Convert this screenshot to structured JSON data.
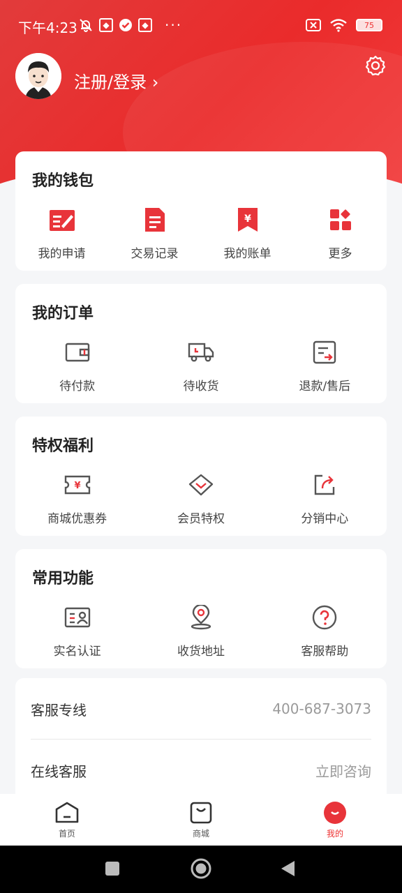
{
  "status": {
    "time": "下午4:23",
    "battery": "75"
  },
  "profile": {
    "login_label": "注册/登录",
    "chevron": "›"
  },
  "wallet": {
    "title": "我的钱包",
    "items": [
      {
        "label": "我的申请",
        "icon": "application-icon"
      },
      {
        "label": "交易记录",
        "icon": "document-icon"
      },
      {
        "label": "我的账单",
        "icon": "bill-icon"
      },
      {
        "label": "更多",
        "icon": "more-grid-icon"
      }
    ]
  },
  "orders": {
    "title": "我的订单",
    "items": [
      {
        "label": "待付款",
        "icon": "wallet-icon"
      },
      {
        "label": "待收货",
        "icon": "truck-icon"
      },
      {
        "label": "退款/售后",
        "icon": "refund-icon"
      }
    ]
  },
  "benefits": {
    "title": "特权福利",
    "items": [
      {
        "label": "商城优惠券",
        "icon": "coupon-icon"
      },
      {
        "label": "会员特权",
        "icon": "diamond-icon"
      },
      {
        "label": "分销中心",
        "icon": "share-icon"
      }
    ]
  },
  "functions": {
    "title": "常用功能",
    "items": [
      {
        "label": "实名认证",
        "icon": "id-card-icon"
      },
      {
        "label": "收货地址",
        "icon": "location-icon"
      },
      {
        "label": "客服帮助",
        "icon": "help-icon"
      }
    ]
  },
  "service": {
    "hotline_label": "客服专线",
    "hotline_value": "400-687-3073",
    "online_label": "在线客服",
    "online_value": "立即咨询"
  },
  "tabbar": {
    "home": "首页",
    "mall": "商城",
    "mine": "我的"
  },
  "colors": {
    "accent": "#e8343a",
    "icon_gray": "#555555"
  }
}
